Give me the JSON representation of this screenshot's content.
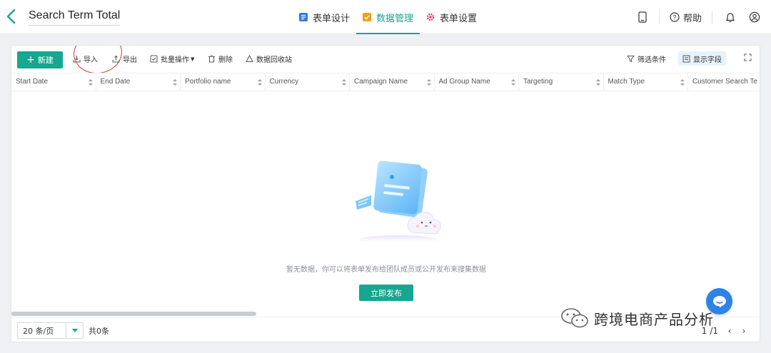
{
  "header": {
    "title": "Search Term Total",
    "tabs": [
      {
        "label": "表单设计",
        "icon": "form-design-icon",
        "color": "#2f7de1"
      },
      {
        "label": "数据管理",
        "icon": "data-manage-icon",
        "color": "#f0a020",
        "active": true
      },
      {
        "label": "表单设置",
        "icon": "gear-icon",
        "color": "#e0315a"
      }
    ],
    "help_label": "帮助"
  },
  "toolbar": {
    "new_label": "新建",
    "import_label": "导入",
    "export_label": "导出",
    "batch_label": "批量操作",
    "delete_label": "删除",
    "recycle_label": "数据回收站",
    "filter_label": "筛选条件",
    "fields_label": "显示字段"
  },
  "table": {
    "columns": [
      "Start Date",
      "End Date",
      "Portfolio name",
      "Currency",
      "Campaign Name",
      "Ad Group Name",
      "Targeting",
      "Match Type",
      "Customer Search Te"
    ]
  },
  "empty_state": {
    "message": "暂无数据，你可以将表单发布给团队成员或公开发布来搜集数据",
    "publish_label": "立即发布"
  },
  "footer": {
    "page_size": "20 条/页",
    "total": "共0条",
    "current_page": "1",
    "page_sep": "/1"
  },
  "watermark": {
    "text": "跨境电商产品分析"
  },
  "colors": {
    "accent": "#17a68f",
    "annotation_circle": "#d9372c",
    "chat": "#2f83e6"
  }
}
